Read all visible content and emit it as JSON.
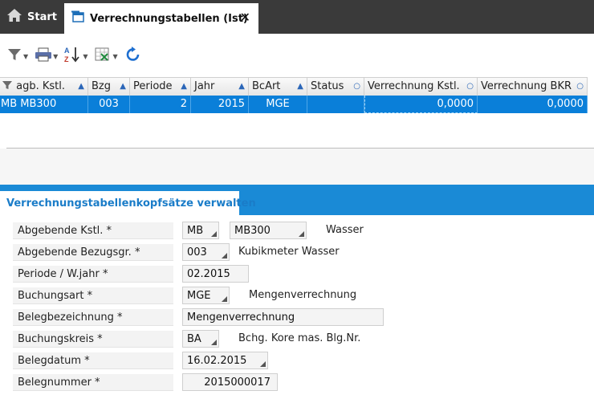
{
  "tabs": {
    "start_label": "Start",
    "active_label": "Verrechnungstabellen (Ist)",
    "close_glyph": "✕"
  },
  "toolbar": {
    "icons": [
      "filter-icon",
      "print-icon",
      "sort-az-icon",
      "excel-export-icon",
      "refresh-icon"
    ]
  },
  "grid": {
    "columns": [
      "agb. Kstl.",
      "Bzg",
      "Periode",
      "Jahr",
      "BcArt",
      "Status",
      "Verrechnung Kstl.",
      "Verrechnung BKR"
    ],
    "rows": [
      {
        "agb_kstl": "MB MB300",
        "bzg": "003",
        "periode": "2",
        "jahr": "2015",
        "bcart": "MGE",
        "status": "",
        "verr_kstl": "0,0000",
        "verr_bkr": "0,0000"
      }
    ]
  },
  "section": {
    "title": "Verrechnungstabellenkopfsätze verwalten"
  },
  "form": {
    "abgebende_kstl": {
      "label": "Abgebende Kstl. *",
      "value1": "MB",
      "value2": "MB300",
      "desc": "Wasser"
    },
    "bezugsgr": {
      "label": "Abgebende Bezugsgr. *",
      "value": "003",
      "desc": "Kubikmeter Wasser"
    },
    "periode": {
      "label": "Periode / W.jahr *",
      "value": "02.2015"
    },
    "buchungsart": {
      "label": "Buchungsart *",
      "value": "MGE",
      "desc": "Mengenverrechnung"
    },
    "belegbezeichnung": {
      "label": "Belegbezeichnung *",
      "value": "Mengenverrechnung"
    },
    "buchungskreis": {
      "label": "Buchungskreis *",
      "value": "BA",
      "desc": "Bchg. Kore mas. Blg.Nr."
    },
    "belegdatum": {
      "label": "Belegdatum *",
      "value": "16.02.2015"
    },
    "belegnummer": {
      "label": "Belegnummer *",
      "value": "2015000017"
    }
  },
  "colors": {
    "accent": "#1a8ad6",
    "selected_row": "#0a7fd9",
    "tabbar": "#3a3a3a"
  }
}
